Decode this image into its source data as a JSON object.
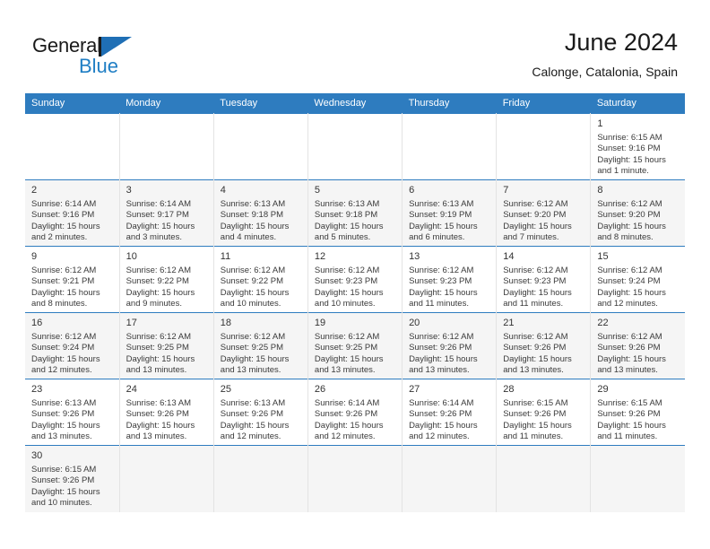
{
  "brand": {
    "name_part1": "General",
    "name_part2": "Blue",
    "flag_icon": "blue-triangle-flag-icon",
    "accent_color": "#1f7ec4"
  },
  "header": {
    "title": "June 2024",
    "subtitle": "Calonge, Catalonia, Spain"
  },
  "calendar": {
    "header_bg": "#2e7cbf",
    "weekdays": [
      "Sunday",
      "Monday",
      "Tuesday",
      "Wednesday",
      "Thursday",
      "Friday",
      "Saturday"
    ],
    "weeks": [
      [
        {
          "day": "",
          "sunrise": "",
          "sunset": "",
          "daylight1": "",
          "daylight2": ""
        },
        {
          "day": "",
          "sunrise": "",
          "sunset": "",
          "daylight1": "",
          "daylight2": ""
        },
        {
          "day": "",
          "sunrise": "",
          "sunset": "",
          "daylight1": "",
          "daylight2": ""
        },
        {
          "day": "",
          "sunrise": "",
          "sunset": "",
          "daylight1": "",
          "daylight2": ""
        },
        {
          "day": "",
          "sunrise": "",
          "sunset": "",
          "daylight1": "",
          "daylight2": ""
        },
        {
          "day": "",
          "sunrise": "",
          "sunset": "",
          "daylight1": "",
          "daylight2": ""
        },
        {
          "day": "1",
          "sunrise": "Sunrise: 6:15 AM",
          "sunset": "Sunset: 9:16 PM",
          "daylight1": "Daylight: 15 hours",
          "daylight2": "and 1 minute."
        }
      ],
      [
        {
          "day": "2",
          "sunrise": "Sunrise: 6:14 AM",
          "sunset": "Sunset: 9:16 PM",
          "daylight1": "Daylight: 15 hours",
          "daylight2": "and 2 minutes."
        },
        {
          "day": "3",
          "sunrise": "Sunrise: 6:14 AM",
          "sunset": "Sunset: 9:17 PM",
          "daylight1": "Daylight: 15 hours",
          "daylight2": "and 3 minutes."
        },
        {
          "day": "4",
          "sunrise": "Sunrise: 6:13 AM",
          "sunset": "Sunset: 9:18 PM",
          "daylight1": "Daylight: 15 hours",
          "daylight2": "and 4 minutes."
        },
        {
          "day": "5",
          "sunrise": "Sunrise: 6:13 AM",
          "sunset": "Sunset: 9:18 PM",
          "daylight1": "Daylight: 15 hours",
          "daylight2": "and 5 minutes."
        },
        {
          "day": "6",
          "sunrise": "Sunrise: 6:13 AM",
          "sunset": "Sunset: 9:19 PM",
          "daylight1": "Daylight: 15 hours",
          "daylight2": "and 6 minutes."
        },
        {
          "day": "7",
          "sunrise": "Sunrise: 6:12 AM",
          "sunset": "Sunset: 9:20 PM",
          "daylight1": "Daylight: 15 hours",
          "daylight2": "and 7 minutes."
        },
        {
          "day": "8",
          "sunrise": "Sunrise: 6:12 AM",
          "sunset": "Sunset: 9:20 PM",
          "daylight1": "Daylight: 15 hours",
          "daylight2": "and 8 minutes."
        }
      ],
      [
        {
          "day": "9",
          "sunrise": "Sunrise: 6:12 AM",
          "sunset": "Sunset: 9:21 PM",
          "daylight1": "Daylight: 15 hours",
          "daylight2": "and 8 minutes."
        },
        {
          "day": "10",
          "sunrise": "Sunrise: 6:12 AM",
          "sunset": "Sunset: 9:22 PM",
          "daylight1": "Daylight: 15 hours",
          "daylight2": "and 9 minutes."
        },
        {
          "day": "11",
          "sunrise": "Sunrise: 6:12 AM",
          "sunset": "Sunset: 9:22 PM",
          "daylight1": "Daylight: 15 hours",
          "daylight2": "and 10 minutes."
        },
        {
          "day": "12",
          "sunrise": "Sunrise: 6:12 AM",
          "sunset": "Sunset: 9:23 PM",
          "daylight1": "Daylight: 15 hours",
          "daylight2": "and 10 minutes."
        },
        {
          "day": "13",
          "sunrise": "Sunrise: 6:12 AM",
          "sunset": "Sunset: 9:23 PM",
          "daylight1": "Daylight: 15 hours",
          "daylight2": "and 11 minutes."
        },
        {
          "day": "14",
          "sunrise": "Sunrise: 6:12 AM",
          "sunset": "Sunset: 9:23 PM",
          "daylight1": "Daylight: 15 hours",
          "daylight2": "and 11 minutes."
        },
        {
          "day": "15",
          "sunrise": "Sunrise: 6:12 AM",
          "sunset": "Sunset: 9:24 PM",
          "daylight1": "Daylight: 15 hours",
          "daylight2": "and 12 minutes."
        }
      ],
      [
        {
          "day": "16",
          "sunrise": "Sunrise: 6:12 AM",
          "sunset": "Sunset: 9:24 PM",
          "daylight1": "Daylight: 15 hours",
          "daylight2": "and 12 minutes."
        },
        {
          "day": "17",
          "sunrise": "Sunrise: 6:12 AM",
          "sunset": "Sunset: 9:25 PM",
          "daylight1": "Daylight: 15 hours",
          "daylight2": "and 13 minutes."
        },
        {
          "day": "18",
          "sunrise": "Sunrise: 6:12 AM",
          "sunset": "Sunset: 9:25 PM",
          "daylight1": "Daylight: 15 hours",
          "daylight2": "and 13 minutes."
        },
        {
          "day": "19",
          "sunrise": "Sunrise: 6:12 AM",
          "sunset": "Sunset: 9:25 PM",
          "daylight1": "Daylight: 15 hours",
          "daylight2": "and 13 minutes."
        },
        {
          "day": "20",
          "sunrise": "Sunrise: 6:12 AM",
          "sunset": "Sunset: 9:26 PM",
          "daylight1": "Daylight: 15 hours",
          "daylight2": "and 13 minutes."
        },
        {
          "day": "21",
          "sunrise": "Sunrise: 6:12 AM",
          "sunset": "Sunset: 9:26 PM",
          "daylight1": "Daylight: 15 hours",
          "daylight2": "and 13 minutes."
        },
        {
          "day": "22",
          "sunrise": "Sunrise: 6:12 AM",
          "sunset": "Sunset: 9:26 PM",
          "daylight1": "Daylight: 15 hours",
          "daylight2": "and 13 minutes."
        }
      ],
      [
        {
          "day": "23",
          "sunrise": "Sunrise: 6:13 AM",
          "sunset": "Sunset: 9:26 PM",
          "daylight1": "Daylight: 15 hours",
          "daylight2": "and 13 minutes."
        },
        {
          "day": "24",
          "sunrise": "Sunrise: 6:13 AM",
          "sunset": "Sunset: 9:26 PM",
          "daylight1": "Daylight: 15 hours",
          "daylight2": "and 13 minutes."
        },
        {
          "day": "25",
          "sunrise": "Sunrise: 6:13 AM",
          "sunset": "Sunset: 9:26 PM",
          "daylight1": "Daylight: 15 hours",
          "daylight2": "and 12 minutes."
        },
        {
          "day": "26",
          "sunrise": "Sunrise: 6:14 AM",
          "sunset": "Sunset: 9:26 PM",
          "daylight1": "Daylight: 15 hours",
          "daylight2": "and 12 minutes."
        },
        {
          "day": "27",
          "sunrise": "Sunrise: 6:14 AM",
          "sunset": "Sunset: 9:26 PM",
          "daylight1": "Daylight: 15 hours",
          "daylight2": "and 12 minutes."
        },
        {
          "day": "28",
          "sunrise": "Sunrise: 6:15 AM",
          "sunset": "Sunset: 9:26 PM",
          "daylight1": "Daylight: 15 hours",
          "daylight2": "and 11 minutes."
        },
        {
          "day": "29",
          "sunrise": "Sunrise: 6:15 AM",
          "sunset": "Sunset: 9:26 PM",
          "daylight1": "Daylight: 15 hours",
          "daylight2": "and 11 minutes."
        }
      ],
      [
        {
          "day": "30",
          "sunrise": "Sunrise: 6:15 AM",
          "sunset": "Sunset: 9:26 PM",
          "daylight1": "Daylight: 15 hours",
          "daylight2": "and 10 minutes."
        },
        {
          "day": "",
          "sunrise": "",
          "sunset": "",
          "daylight1": "",
          "daylight2": ""
        },
        {
          "day": "",
          "sunrise": "",
          "sunset": "",
          "daylight1": "",
          "daylight2": ""
        },
        {
          "day": "",
          "sunrise": "",
          "sunset": "",
          "daylight1": "",
          "daylight2": ""
        },
        {
          "day": "",
          "sunrise": "",
          "sunset": "",
          "daylight1": "",
          "daylight2": ""
        },
        {
          "day": "",
          "sunrise": "",
          "sunset": "",
          "daylight1": "",
          "daylight2": ""
        },
        {
          "day": "",
          "sunrise": "",
          "sunset": "",
          "daylight1": "",
          "daylight2": ""
        }
      ]
    ]
  }
}
